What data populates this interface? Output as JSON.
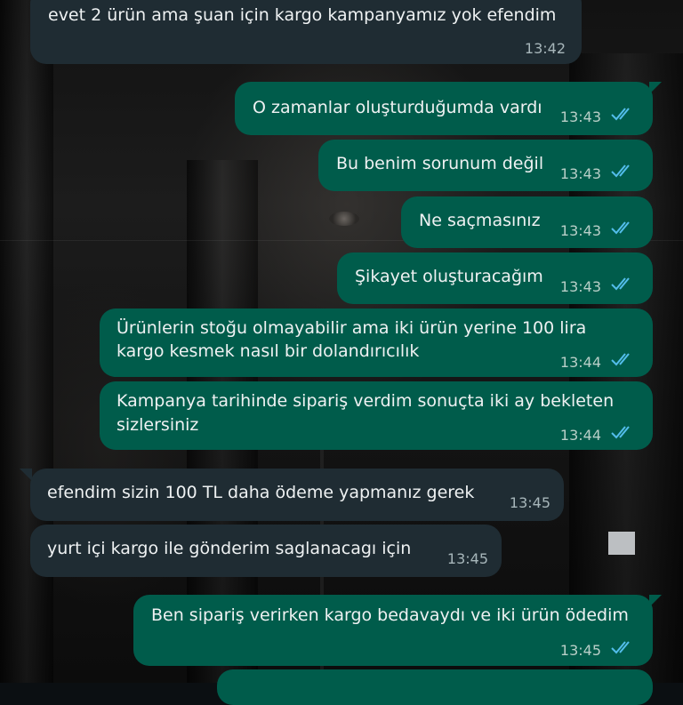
{
  "colors": {
    "incoming_bubble": "#1f2c33",
    "outgoing_bubble": "#005c4b",
    "read_ticks": "#53bdeb"
  },
  "messages": [
    {
      "direction": "incoming",
      "lines": [
        "evet 2 ürün ama şuan için kargo kampanyamız yok efendim"
      ],
      "time": "13:42"
    },
    {
      "direction": "outgoing",
      "lines": [
        "O zamanlar oluşturduğumda vardı"
      ],
      "time": "13:43",
      "status": "read-double-check-icon"
    },
    {
      "direction": "outgoing",
      "lines": [
        "Bu benim sorunum değil"
      ],
      "time": "13:43",
      "status": "read-double-check-icon"
    },
    {
      "direction": "outgoing",
      "lines": [
        "Ne saçmasınız"
      ],
      "time": "13:43",
      "status": "read-double-check-icon"
    },
    {
      "direction": "outgoing",
      "lines": [
        "Şikayet oluşturacağım"
      ],
      "time": "13:43",
      "status": "read-double-check-icon"
    },
    {
      "direction": "outgoing",
      "lines": [
        "Ürünlerin stoğu olmayabilir ama iki ürün yerine 100 lira",
        "kargo kesmek nasıl bir dolandırıcılık"
      ],
      "time": "13:44",
      "status": "read-double-check-icon"
    },
    {
      "direction": "outgoing",
      "lines": [
        "Kampanya tarihinde sipariş verdim sonuçta iki ay bekleten",
        "sizlersiniz"
      ],
      "time": "13:44",
      "status": "read-double-check-icon"
    },
    {
      "direction": "incoming",
      "lines": [
        "efendim sizin 100 TL daha ödeme yapmanız gerek"
      ],
      "time": "13:45"
    },
    {
      "direction": "incoming",
      "lines": [
        "yurt içi kargo ile gönderim saglanacagı için"
      ],
      "time": "13:45"
    },
    {
      "direction": "outgoing",
      "lines": [
        "Ben sipariş verirken kargo bedavaydı ve iki ürün ödedim"
      ],
      "time": "13:45",
      "status": "read-double-check-icon"
    }
  ]
}
